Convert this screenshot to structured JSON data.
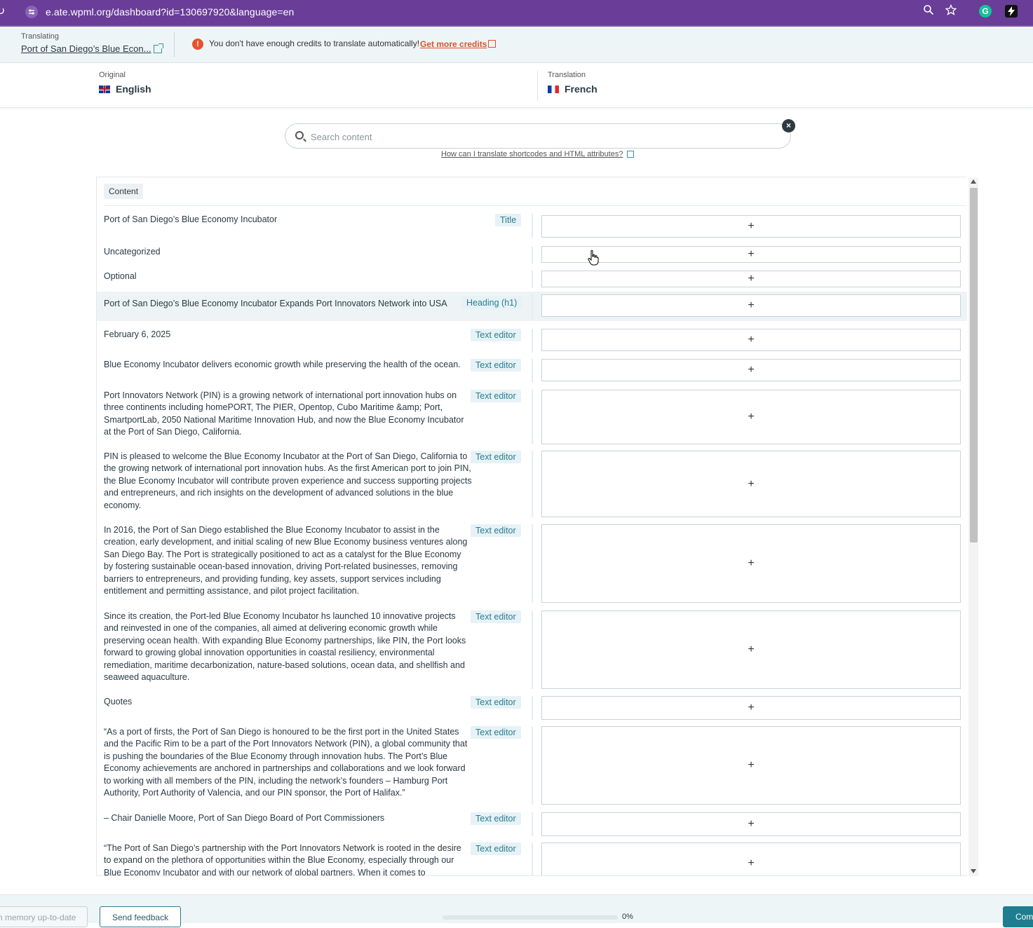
{
  "browser": {
    "url": "e.ate.wpml.org/dashboard?id=130697920&language=en"
  },
  "header": {
    "translating_label": "Translating",
    "document_title": "Port of San Diego’s Blue Econ...",
    "warning_text": "You don't have enough credits to translate automatically!",
    "warning_link": "Get more credits"
  },
  "languages": {
    "original_label": "Original",
    "original": "English",
    "translation_label": "Translation",
    "translation": "French"
  },
  "search": {
    "placeholder": "Search content",
    "help_link": "How can I translate shortcodes and HTML attributes?"
  },
  "panel": {
    "tab": "Content"
  },
  "rows": [
    {
      "text": "Port of San Diego’s Blue Economy Incubator",
      "tag": "Title"
    },
    {
      "text": "Uncategorized",
      "tag": ""
    },
    {
      "text": "Optional",
      "tag": ""
    },
    {
      "text": "Port of San Diego’s Blue Economy Incubator Expands Port Innovators Network into USA",
      "tag": "Heading (h1)"
    },
    {
      "text": "February 6, 2025",
      "tag": "Text editor"
    },
    {
      "text": "Blue Economy Incubator delivers economic growth while preserving the health of the ocean.",
      "tag": "Text editor"
    },
    {
      "text": "Port Innovators Network (PIN) is a growing network of international port innovation hubs on three continents including homePORT, The PIER, Opentop, Cubo Maritime &amp; Port, SmartportLab, 2050 National Maritime Innovation Hub, and now the Blue Economy Incubator at the Port of San Diego, California.",
      "tag": "Text editor"
    },
    {
      "text": "PIN is pleased to welcome the Blue Economy Incubator at the Port of San Diego, California to the growing network of international port innovation hubs. As the first American port to join PIN, the Blue Economy Incubator will contribute proven experience and success supporting projects and entrepreneurs, and rich insights on the development of advanced solutions in the blue economy.",
      "tag": "Text editor"
    },
    {
      "text": "In 2016, the Port of San Diego established the Blue Economy Incubator to assist in the creation, early development, and initial scaling of new Blue Economy business ventures along San Diego Bay. The Port is strategically positioned to act as a catalyst for the Blue Economy by fostering sustainable ocean-based innovation, driving Port-related businesses, removing barriers to entrepreneurs, and providing funding, key assets, support services including entitlement and permitting assistance, and pilot project facilitation.",
      "tag": "Text editor"
    },
    {
      "text": "Since its creation, the Port-led Blue Economy Incubator hs launched 10 innovative projects and reinvested in one of the companies, all aimed at delivering economic growth while preserving ocean health. With expanding Blue Economy partnerships, like PIN, the Port looks forward to growing global innovation opportunities in coastal resiliency, environmental remediation, maritime decarbonization, nature-based solutions, ocean data, and shellfish and seaweed aquaculture.",
      "tag": "Text editor"
    },
    {
      "text": "Quotes",
      "tag": "Text editor"
    },
    {
      "text": "“As a port of firsts, the Port of San Diego is honoured to be the first port in the United States and the Pacific Rim to be a part of the Port Innovators Network (PIN), a global community that is pushing the boundaries of the Blue Economy through innovation hubs. The Port’s Blue Economy achievements are anchored in partnerships and collaborations and we look forward to working with all members of the PIN, including the network’s founders – Hamburg Port Authority, Port Authority of Valencia, and our PIN sponsor, the Port of Halifax.”",
      "tag": "Text editor"
    },
    {
      "text": "– Chair Danielle Moore, Port of San Diego Board of Port Commissioners",
      "tag": "Text editor"
    },
    {
      "text": "“The Port of San Diego’s partnership with the Port Innovators Network is rooted in the desire to expand on the plethora of opportunities within the Blue Economy, especially through our Blue Economy Incubator and with our network of global partners. When it comes to",
      "tag": "Text editor"
    }
  ],
  "footer": {
    "memory_button": "n memory up-to-date",
    "feedback_button": "Send feedback",
    "progress": 0,
    "progress_label": "0%",
    "complete_button": "Com"
  },
  "icons": {
    "reload": "reload-icon",
    "site_info": "tune-icon",
    "zoom": "zoom-icon",
    "star": "star-icon",
    "grammarly": "grammarly-icon",
    "extension": "bolt-icon",
    "add": "plus-icon"
  }
}
